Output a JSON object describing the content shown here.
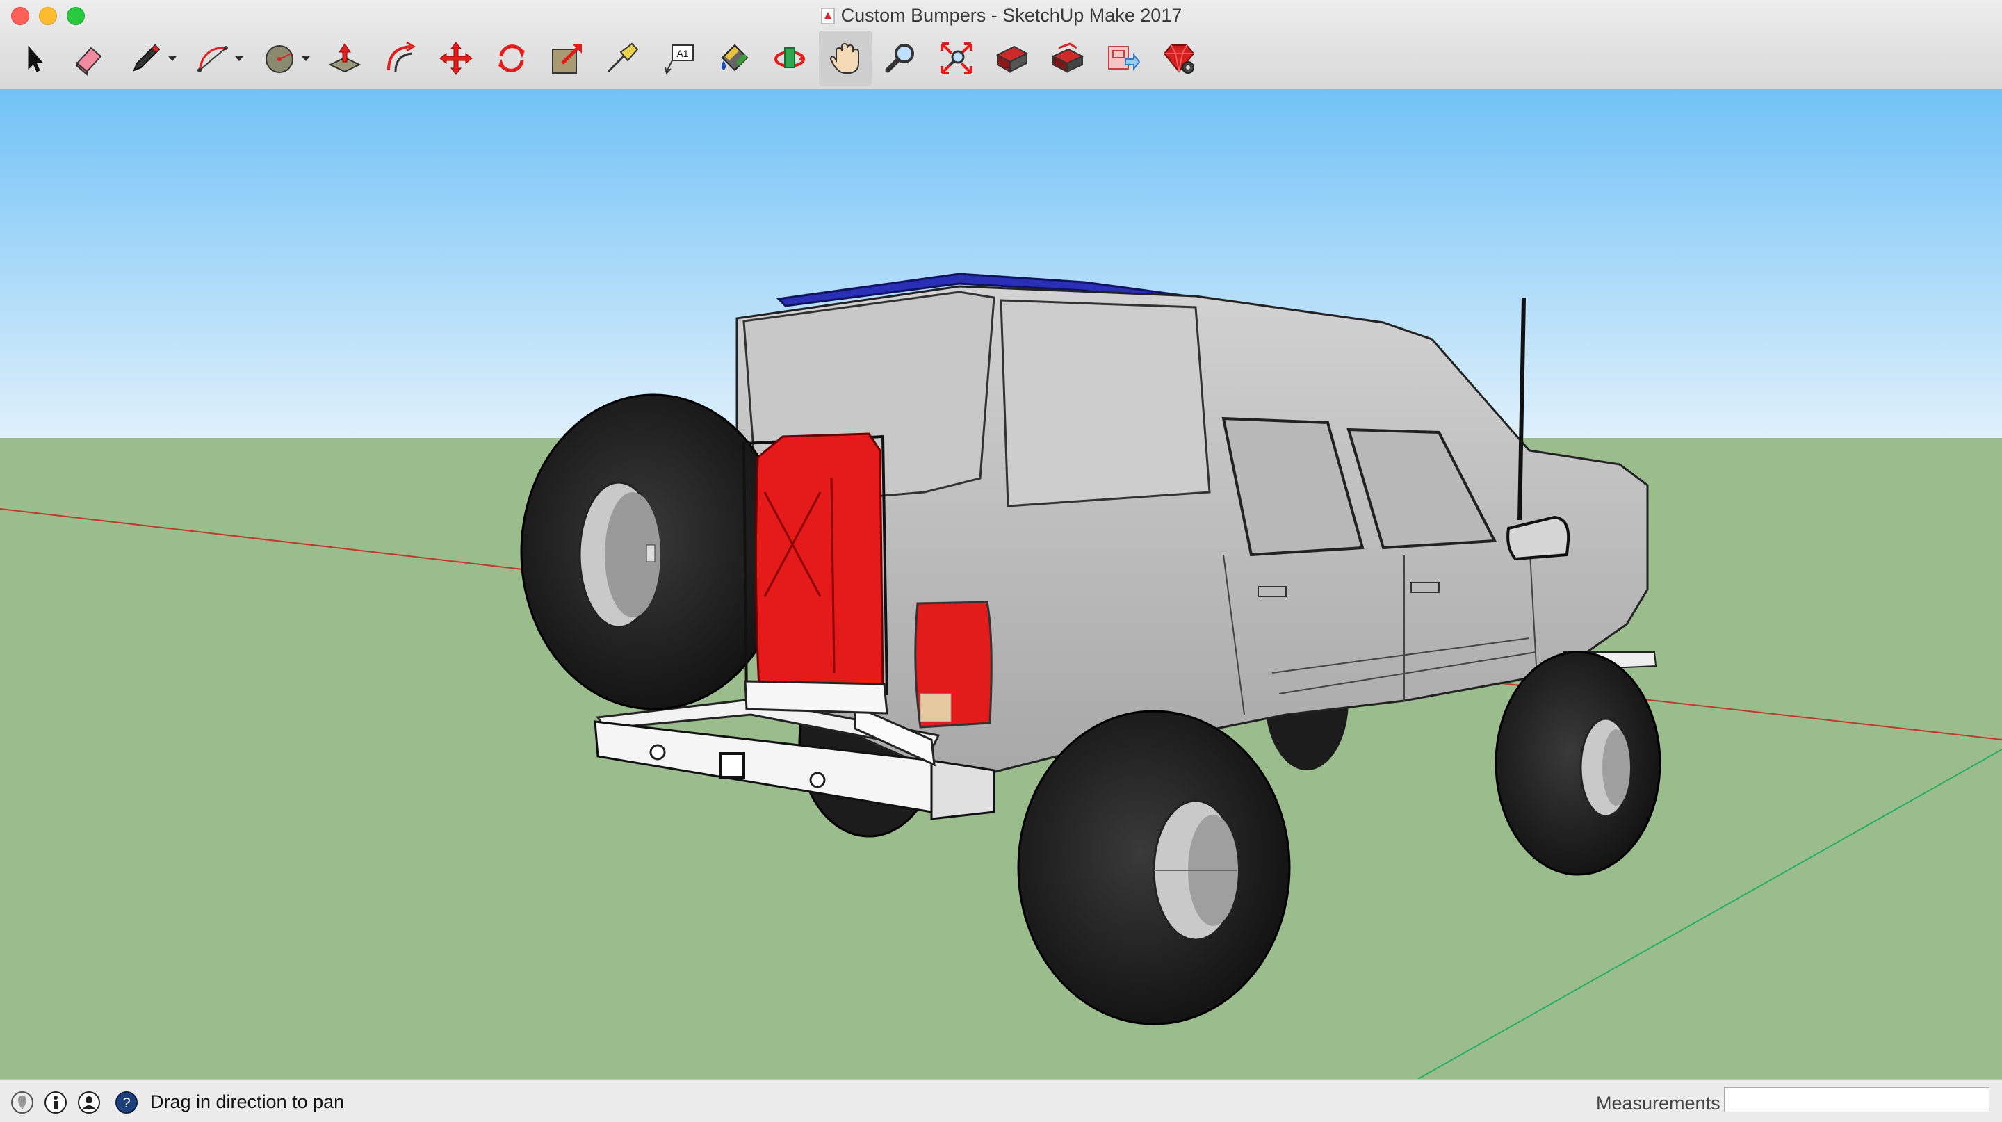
{
  "window": {
    "title": "Custom Bumpers - SketchUp Make 2017"
  },
  "toolbar": {
    "active_tool": "pan",
    "tools": [
      {
        "id": "select",
        "icon": "select-arrow-icon"
      },
      {
        "id": "eraser",
        "icon": "eraser-icon"
      },
      {
        "id": "line",
        "icon": "pencil-icon",
        "dropdown": true
      },
      {
        "id": "arc",
        "icon": "arc-icon",
        "dropdown": true
      },
      {
        "id": "shapes",
        "icon": "circle-shapes-icon",
        "dropdown": true
      },
      {
        "id": "push-pull",
        "icon": "push-pull-icon"
      },
      {
        "id": "offset",
        "icon": "offset-icon"
      },
      {
        "id": "move",
        "icon": "move-icon"
      },
      {
        "id": "rotate",
        "icon": "rotate-icon"
      },
      {
        "id": "scale",
        "icon": "scale-icon"
      },
      {
        "id": "tape-measure",
        "icon": "tape-measure-icon"
      },
      {
        "id": "text",
        "icon": "text-tool-icon",
        "label": "A1"
      },
      {
        "id": "paint-bucket",
        "icon": "paint-bucket-icon"
      },
      {
        "id": "orbit",
        "icon": "orbit-icon"
      },
      {
        "id": "pan",
        "icon": "pan-hand-icon"
      },
      {
        "id": "zoom",
        "icon": "zoom-icon"
      },
      {
        "id": "zoom-extents",
        "icon": "zoom-extents-icon"
      },
      {
        "id": "3d-warehouse",
        "icon": "warehouse-icon"
      },
      {
        "id": "extension-warehouse",
        "icon": "extension-warehouse-icon"
      },
      {
        "id": "share-model",
        "icon": "share-model-icon"
      },
      {
        "id": "extension-manager",
        "icon": "ruby-gem-icon"
      }
    ]
  },
  "scene": {
    "sky_color": "#7cc6f5",
    "ground_color": "#9bbd8e",
    "red_axis_color": "#c0392b",
    "green_axis_color": "#27ae60",
    "model_color": "#c9c9c9",
    "jerry_can_color": "#e51b1b",
    "roof_rack_color": "#2a2fb8"
  },
  "status_bar": {
    "hint": "Drag in direction to pan",
    "measurements_label": "Measurements",
    "measurements_value": ""
  }
}
